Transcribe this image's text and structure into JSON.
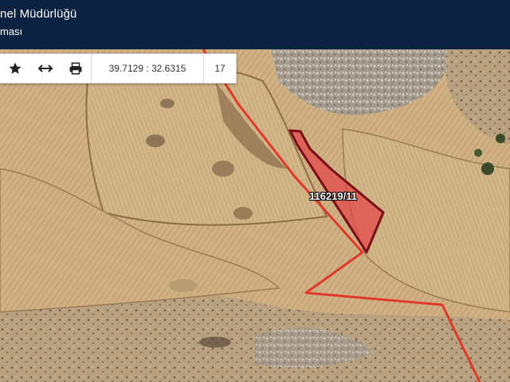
{
  "header": {
    "title": "nel Müdürlüğü",
    "subtitle": "ması"
  },
  "toolbar": {
    "icons": [
      "star-icon",
      "horizontal-measure-icon",
      "print-icon"
    ],
    "coordinates": "39.7129 : 32.6315",
    "zoom": "17"
  },
  "map": {
    "parcel_label": "116219/11",
    "colors": {
      "boundary_line": "#e0392b",
      "parcel_fill": "#e34a4a",
      "parcel_stroke": "#7a0d16",
      "header_bg": "#0b2240"
    }
  }
}
